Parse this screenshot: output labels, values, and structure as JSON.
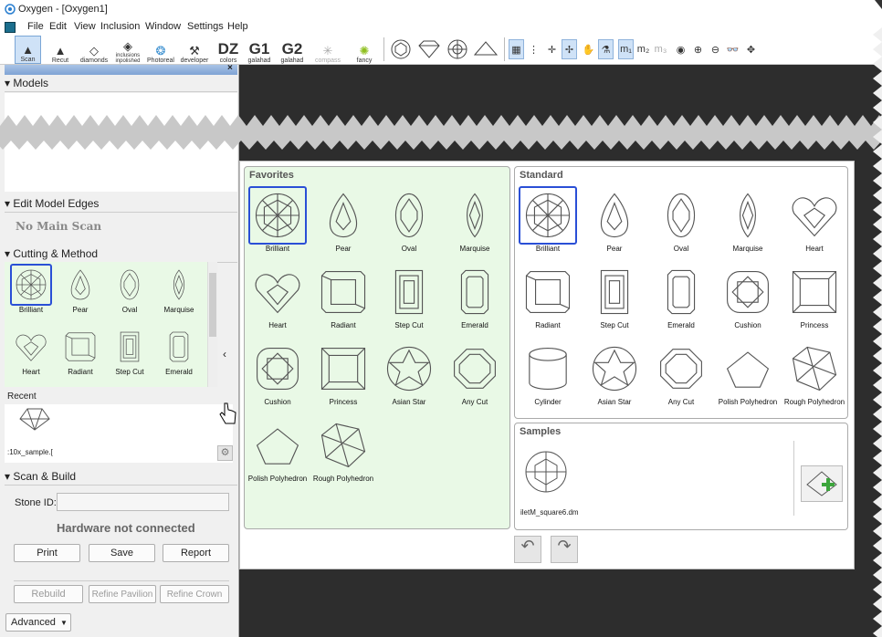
{
  "window": {
    "title": "Oxygen - [Oxygen1]"
  },
  "menu": [
    "File",
    "Edit",
    "View",
    "Inclusion",
    "Window",
    "Settings",
    "Help"
  ],
  "toolbar": {
    "buttons": [
      {
        "label": "Scan",
        "glyph": "▲"
      },
      {
        "label": "Recut",
        "glyph": "▲"
      },
      {
        "label": "diamonds",
        "glyph": "◇"
      },
      {
        "label": "inclusions inpolished",
        "glyph": "◈"
      },
      {
        "label": "Photoreal",
        "glyph": "❂"
      },
      {
        "label": "developer",
        "glyph": "⚒"
      },
      {
        "label": "colors",
        "glyph": "DZ"
      },
      {
        "label": "galahad",
        "glyph": "G1"
      },
      {
        "label": "galahad",
        "glyph": "G2"
      },
      {
        "label": "compass",
        "glyph": "✳"
      },
      {
        "label": "fancy",
        "glyph": "✺"
      }
    ],
    "view_icons": [
      "round-gem-icon",
      "crown-icon",
      "table-view-icon",
      "pavilion-icon"
    ],
    "tools": [
      "▦",
      "⋮",
      "✛",
      "✢",
      "✋",
      "⚗",
      "m₁",
      "m₂",
      "m₃",
      "◉",
      "⊕",
      "⊖",
      "👓",
      "✥"
    ]
  },
  "left": {
    "models_title": "Models",
    "edit_edges_title": "Edit Model Edges",
    "no_main_scan": "No Main Scan",
    "cutting_title": "Cutting & Method",
    "cutting_items": [
      "Brilliant",
      "Pear",
      "Oval",
      "Marquise",
      "Heart",
      "Radiant",
      "Step Cut",
      "Emerald"
    ],
    "recent_title": "Recent",
    "recent_file": ":10x_sample.[",
    "scan_build_title": "Scan & Build",
    "stone_id_label": "Stone ID:",
    "stone_id_value": "",
    "hardware_status": "Hardware not connected",
    "print": "Print",
    "save": "Save",
    "report": "Report",
    "rebuild": "Rebuild",
    "refine_pavilion": "Refine Pavilion",
    "refine_crown": "Refine Crown",
    "advanced": "Advanced"
  },
  "dialog": {
    "favorites_title": "Favorites",
    "favorites": [
      "Brilliant",
      "Pear",
      "Oval",
      "Marquise",
      "Heart",
      "Radiant",
      "Step Cut",
      "Emerald",
      "Cushion",
      "Princess",
      "Asian Star",
      "Any Cut",
      "Polish Polyhedron",
      "Rough Polyhedron"
    ],
    "standard_title": "Standard",
    "standard": [
      "Brilliant",
      "Pear",
      "Oval",
      "Marquise",
      "Heart",
      "Radiant",
      "Step Cut",
      "Emerald",
      "Cushion",
      "Princess",
      "Cylinder",
      "Asian Star",
      "Any Cut",
      "Polish Polyhedron",
      "Rough Polyhedron"
    ],
    "samples_title": "Samples",
    "sample_file": "iletM_square6.dm"
  },
  "colors": {
    "selection": "#2a4fd6",
    "favorites_bg": "#e9f9e6",
    "dark_bg": "#2d2d2d"
  }
}
